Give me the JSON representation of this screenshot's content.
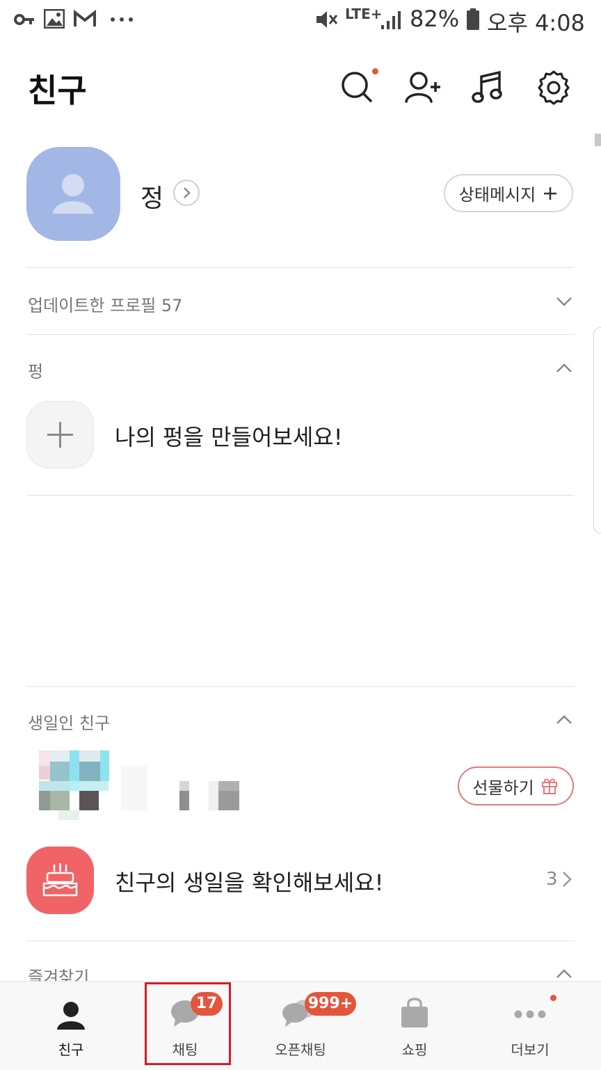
{
  "status_bar": {
    "battery": "82%",
    "network": "LTE+",
    "time": "오후 4:08",
    "notification_icons": [
      "key-icon",
      "image-icon",
      "gmail-icon",
      "more-icon"
    ]
  },
  "header": {
    "title": "친구",
    "icons": [
      "search-icon",
      "add-friend-icon",
      "music-icon",
      "settings-icon"
    ]
  },
  "profile": {
    "name": "정",
    "status_button_label": "상태메시지"
  },
  "sections": {
    "updated_profiles": {
      "label": "업데이트한 프로필 57"
    },
    "pung": {
      "label": "펑",
      "cta": "나의 펑을 만들어보세요!"
    },
    "birthday": {
      "label": "생일인 친구",
      "gift_button": "선물하기",
      "cta": "친구의 생일을 확인해보세요!",
      "count": "3"
    },
    "favorites": {
      "label": "즐겨찾기"
    }
  },
  "bottom_nav": {
    "items": [
      {
        "label": "친구",
        "icon": "person-icon"
      },
      {
        "label": "채팅",
        "icon": "chat-icon",
        "badge": "17"
      },
      {
        "label": "오픈채팅",
        "icon": "open-chat-icon",
        "badge": "999+"
      },
      {
        "label": "쇼핑",
        "icon": "shopping-bag-icon"
      },
      {
        "label": "더보기",
        "icon": "more-icon"
      }
    ]
  },
  "colors": {
    "accent_red": "#e4553b",
    "avatar_blue": "#a3b7e6",
    "birthday_red": "#f06366",
    "highlight": "#d81a22"
  }
}
